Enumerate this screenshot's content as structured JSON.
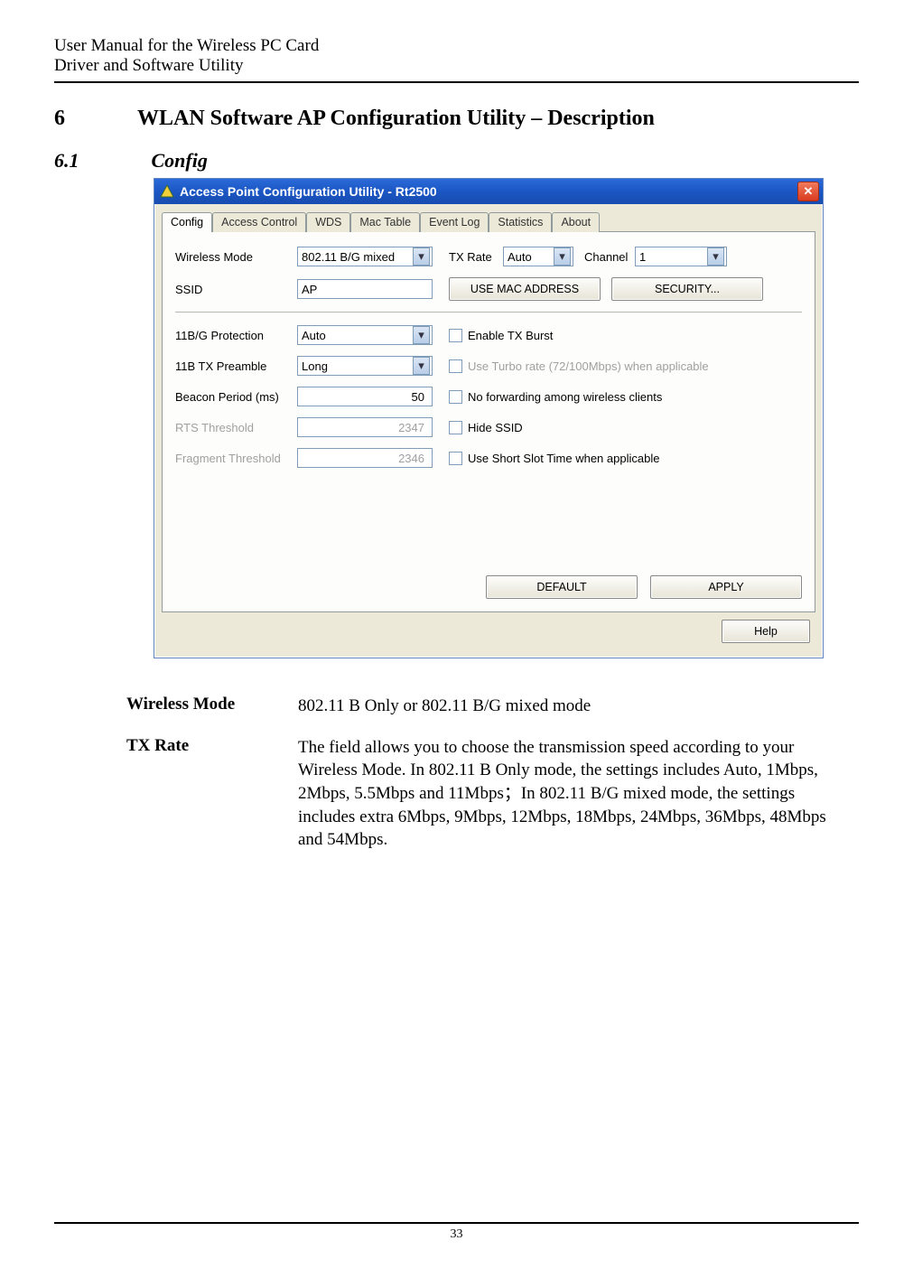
{
  "header": {
    "line1": "User Manual for the Wireless PC Card",
    "line2": "Driver and Software Utility"
  },
  "chapter": {
    "num": "6",
    "title": "WLAN Software AP Configuration Utility – Description"
  },
  "section": {
    "num": "6.1",
    "title": "Config"
  },
  "win": {
    "title": "Access Point Configuration Utility - Rt2500",
    "close_glyph": "✕",
    "tabs": [
      "Config",
      "Access Control",
      "WDS",
      "Mac Table",
      "Event Log",
      "Statistics",
      "About"
    ],
    "fields": {
      "wireless_mode": {
        "label": "Wireless Mode",
        "value": "802.11 B/G mixed"
      },
      "tx_rate": {
        "label": "TX Rate",
        "value": "Auto"
      },
      "channel": {
        "label": "Channel",
        "value": "1"
      },
      "ssid": {
        "label": "SSID",
        "value": "AP"
      },
      "use_mac": {
        "label": "USE MAC ADDRESS"
      },
      "security": {
        "label": "SECURITY..."
      },
      "protection": {
        "label": "11B/G Protection",
        "value": "Auto"
      },
      "preamble": {
        "label": "11B TX Preamble",
        "value": "Long"
      },
      "beacon": {
        "label": "Beacon Period (ms)",
        "value": "50"
      },
      "rts": {
        "label": "RTS Threshold",
        "value": "2347"
      },
      "frag": {
        "label": "Fragment Threshold",
        "value": "2346"
      },
      "enable_tx_burst": {
        "label": "Enable TX Burst"
      },
      "use_turbo": {
        "label": "Use Turbo rate (72/100Mbps)  when applicable"
      },
      "no_forwarding": {
        "label": "No forwarding among wireless clients"
      },
      "hide_ssid": {
        "label": "Hide SSID"
      },
      "short_slot": {
        "label": "Use Short Slot Time when applicable"
      },
      "default_btn": "DEFAULT",
      "apply_btn": "APPLY",
      "help_btn": "Help"
    }
  },
  "defs": [
    {
      "term": "Wireless Mode",
      "desc": "802.11 B Only or 802.11 B/G mixed mode"
    },
    {
      "term": "TX Rate",
      "desc": "The field allows you to choose the transmission speed according to your Wireless Mode. In 802.11 B Only mode, the settings includes Auto, 1Mbps, 2Mbps, 5.5Mbps and 11Mbps；In 802.11 B/G mixed mode, the settings includes extra 6Mbps, 9Mbps, 12Mbps, 18Mbps, 24Mbps, 36Mbps, 48Mbps and 54Mbps."
    }
  ],
  "footer": {
    "page": "33"
  }
}
